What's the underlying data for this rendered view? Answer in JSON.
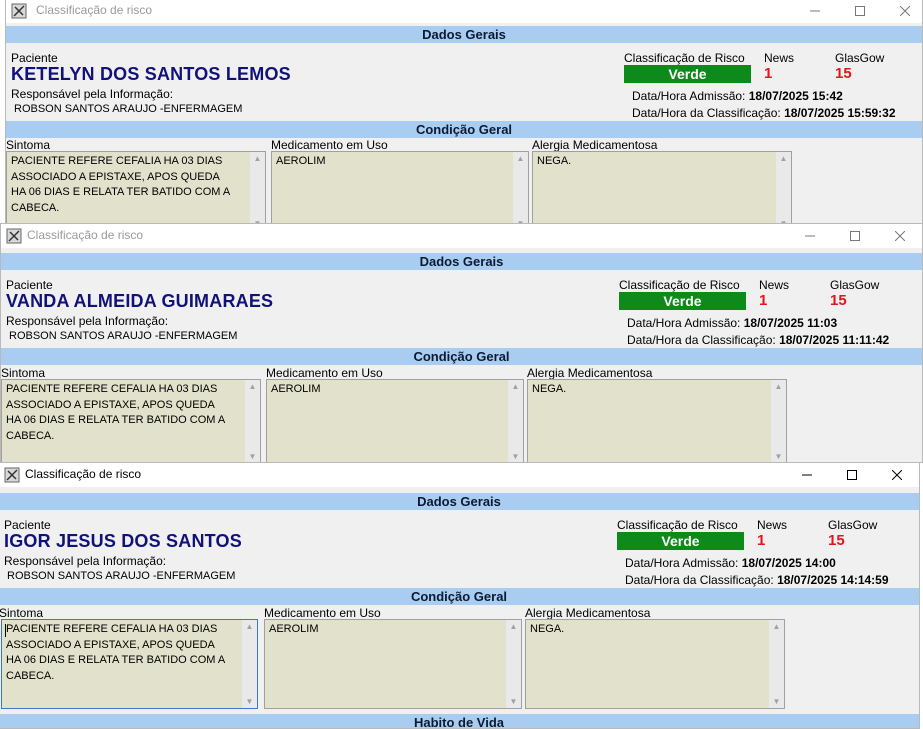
{
  "window_title": "Classificação de risco",
  "labels": {
    "dados_gerais": "Dados Gerais",
    "paciente": "Paciente",
    "responsavel": "Responsável pela Informação:",
    "classificacao": "Classificação de Risco",
    "news": "News",
    "glasgow": "GlasGow",
    "admissao": "Data/Hora Admissão:",
    "classif_dt": "Data/Hora da Classificação:",
    "condicao": "Condição Geral",
    "sintoma": "Sintoma",
    "medicamento": "Medicamento em Uso",
    "alergia": "Alergia Medicamentosa",
    "habito": "Habito de Vida"
  },
  "windows": [
    {
      "patient": "KETELYN DOS SANTOS LEMOS",
      "responsible": "ROBSON SANTOS ARAUJO -ENFERMAGEM",
      "risk": "Verde",
      "news": "1",
      "glasgow": "15",
      "admission": "18/07/2025 15:42",
      "classified": "18/07/2025 15:59:32",
      "symptom": "PACIENTE REFERE CEFALIA HA 03 DIAS\nASSOCIADO A EPISTAXE, APOS QUEDA\nHA 06 DIAS E RELATA TER BATIDO COM A\nCABECA.",
      "medication": "AEROLIM",
      "allergy": "NEGA."
    },
    {
      "patient": "VANDA ALMEIDA GUIMARAES",
      "responsible": "ROBSON SANTOS ARAUJO -ENFERMAGEM",
      "risk": "Verde",
      "news": "1",
      "glasgow": "15",
      "admission": "18/07/2025 11:03",
      "classified": "18/07/2025 11:11:42",
      "symptom": "PACIENTE REFERE CEFALIA HA 03 DIAS\nASSOCIADO A EPISTAXE, APOS QUEDA\nHA 06 DIAS E RELATA TER BATIDO COM A\nCABECA.",
      "medication": "AEROLIM",
      "allergy": "NEGA."
    },
    {
      "patient": "IGOR JESUS DOS SANTOS",
      "responsible": "ROBSON SANTOS ARAUJO -ENFERMAGEM",
      "risk": "Verde",
      "news": "1",
      "glasgow": "15",
      "admission": "18/07/2025 14:00",
      "classified": "18/07/2025 14:14:59",
      "symptom": "PACIENTE REFERE CEFALIA HA 03 DIAS\nASSOCIADO A EPISTAXE, APOS QUEDA\nHA 06 DIAS E RELATA TER BATIDO COM A\nCABECA.",
      "medication": "AEROLIM",
      "allergy": "NEGA."
    }
  ],
  "colors": {
    "section_bar": "#a9cdf0",
    "patient_name": "#11117a",
    "risk_green": "#0e8a1a",
    "score_red": "#e0161a",
    "field_bg": "#e2e1cb"
  }
}
